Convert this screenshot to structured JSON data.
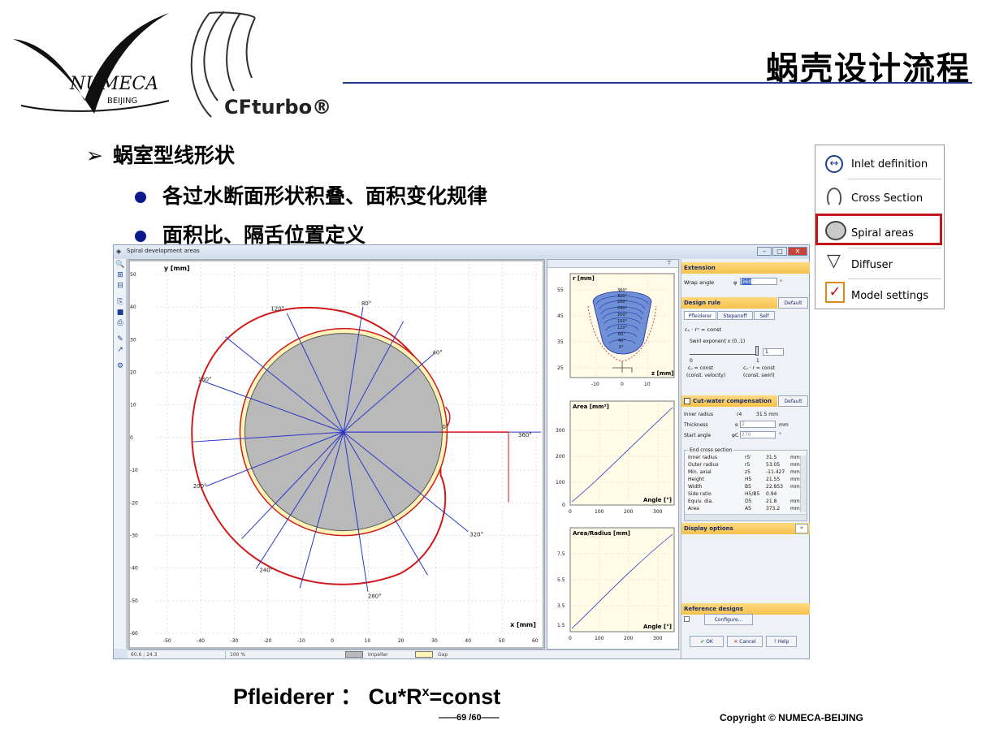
{
  "header": {
    "title": "蜗壳设计流程",
    "numeca_logo_text": "NUMECA",
    "numeca_logo_sub": "BEIJING",
    "cfturbo_logo_text": "CFturbo®"
  },
  "bullets": {
    "level1": "蜗室型线形状",
    "level2": [
      "各过水断面形状积叠、面积变化规律",
      "面积比、隔舌位置定义"
    ]
  },
  "window": {
    "title": "Spiral development areas",
    "main_plot": {
      "ylabel": "y [mm]",
      "xlabel": "x [mm]",
      "yticks": [
        "50",
        "40",
        "30",
        "20",
        "10",
        "0",
        "-10",
        "-20",
        "-30",
        "-40",
        "-50",
        "-60"
      ],
      "xticks": [
        "-50",
        "-40",
        "-30",
        "-20",
        "-10",
        "0",
        "10",
        "20",
        "30",
        "40",
        "50",
        "60"
      ],
      "angle_labels": [
        "120°",
        "80°",
        "40°",
        "160°",
        "0°",
        "360°",
        "200°",
        "240°",
        "280°",
        "320°"
      ]
    },
    "side_plots": {
      "cross_section": {
        "ylabel": "r [mm]",
        "xlabel": "z [mm]",
        "yticks": [
          "55",
          "45",
          "35",
          "25"
        ],
        "xticks": [
          "-10",
          "0",
          "10"
        ],
        "section_labels": [
          "360°",
          "320°",
          "280°",
          "240°",
          "200°",
          "160°",
          "120°",
          "80°",
          "40°",
          "0°"
        ]
      },
      "area": {
        "ylabel": "Area [mm²]",
        "xlabel": "Angle [°]",
        "yticks": [
          "300",
          "200",
          "100",
          "0"
        ],
        "xticks": [
          "0",
          "100",
          "200",
          "300"
        ]
      },
      "area_radius": {
        "ylabel": "Area/Radius [mm]",
        "xlabel": "Angle [°]",
        "yticks": [
          "7.5",
          "5.5",
          "3.5",
          "1.5"
        ],
        "xticks": [
          "0",
          "100",
          "200",
          "300"
        ]
      }
    },
    "status": {
      "coords": "60.6 ; 24.3",
      "zoom": "100 %",
      "legend_impeller": "Impeller",
      "legend_gap": "Gap"
    },
    "panel": {
      "extension_head": "Extension",
      "wrap_angle_label": "Wrap angle",
      "wrap_angle_sym": "φ",
      "wrap_angle_value": "360",
      "wrap_angle_unit": "°",
      "design_rule_head": "Design rule",
      "default_label": "Default",
      "tabs": [
        "Pfleiderer",
        "Stepanoff",
        "Self"
      ],
      "formula1": "cᵤ · rˣ = const",
      "swirl_label": "Swirl exponent x (0..1)",
      "swirl_value": "1",
      "slider_min": "0",
      "slider_max": "1",
      "const_vel": "cᵤ = const",
      "const_vel_sub": "(const. velocity)",
      "const_swirl": "cᵤ · r = const",
      "const_swirl_sub": "(const. swirl)",
      "cutwater_head": "Cut-water compensation",
      "inner_radius_label": "Inner radius",
      "inner_radius_sym": "r4",
      "inner_radius_value": "31.5 mm",
      "thickness_label": "Thickness",
      "thickness_sym": "e",
      "thickness_value": "2",
      "thickness_unit": "mm",
      "start_angle_label": "Start angle",
      "start_angle_sym": "φC",
      "start_angle_value": "270",
      "start_angle_unit": "°",
      "end_section_title": "End cross section",
      "end_section_rows": [
        [
          "Inner radius",
          "r5'",
          "31.5",
          "mm"
        ],
        [
          "Outer radius",
          "r5",
          "53.05",
          "mm"
        ],
        [
          "Min. axial",
          "z5",
          "-11.427",
          "mm"
        ],
        [
          "Height",
          "H5",
          "21.55",
          "mm"
        ],
        [
          "Width",
          "B5",
          "22.853",
          "mm"
        ],
        [
          "Side ratio",
          "H5/B5",
          "0.94",
          ""
        ],
        [
          "Equiv. dia.",
          "D5",
          "21.8",
          "mm"
        ],
        [
          "Area",
          "A5",
          "373.2",
          "mm"
        ]
      ],
      "display_options_head": "Display options",
      "reference_head": "Reference designs",
      "configure_label": "Configure...",
      "ok_label": "OK",
      "cancel_label": "Cancel",
      "help_label": "Help"
    }
  },
  "menu": {
    "items": [
      "Inlet definition",
      "Cross Section",
      "Spiral areas",
      "Diffuser",
      "Model settings"
    ],
    "highlight_color": "#c0161c"
  },
  "footer": {
    "formula_prefix": "Pfleiderer ：",
    "formula_main": "Cu*R",
    "formula_exp": "x",
    "formula_suffix": "=const",
    "page": "——69 /60——",
    "copyright": "Copyright © NUMECA-BEIJING"
  }
}
